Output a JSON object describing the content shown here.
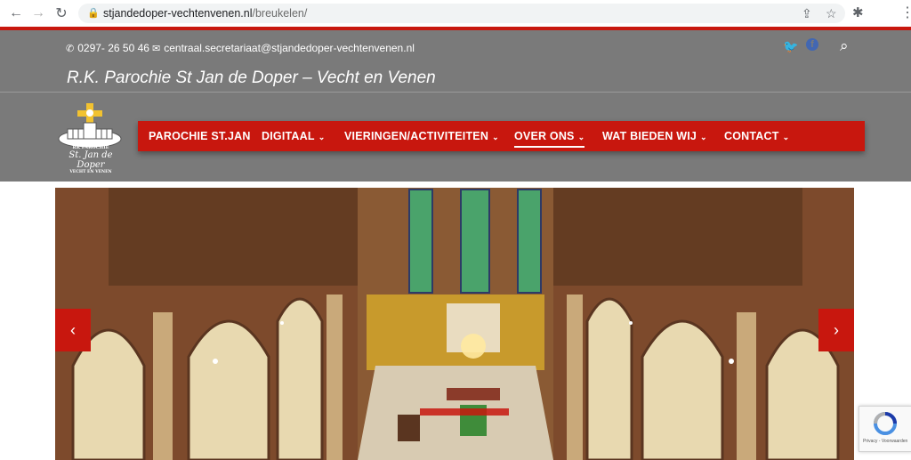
{
  "browser": {
    "url_domain": "stjandedoper-vechtenvenen.nl",
    "url_path": "/breukelen/",
    "back_icon": "←",
    "forward_icon": "→",
    "reload_icon": "↻",
    "lock_icon": "🔒",
    "share_icon": "⇪",
    "star_icon": "☆",
    "extensions_icon": "✱",
    "menu_icon": "⋮"
  },
  "topbar": {
    "phone_icon": "✆",
    "phone": "0297- 26 50 46",
    "email_icon": "✉",
    "email": "centraal.secretariaat@stjandedoper-vechtenvenen.nl",
    "twitter_icon": "🐦",
    "facebook_icon": "f",
    "search_icon": "⌕"
  },
  "site_title": "R.K. Parochie St Jan de Doper – Vecht en Venen",
  "logo": {
    "line1": "RK PAROCHIE",
    "line2": "St. Jan de Doper",
    "line3": "VECHT EN VENEN"
  },
  "nav": {
    "items": [
      {
        "label": "PAROCHIE ST.JAN",
        "chevron": ""
      },
      {
        "label": "DIGITAAL",
        "chevron": "⌄"
      },
      {
        "label": "VIERINGEN/ACTIVITEITEN",
        "chevron": "⌄"
      },
      {
        "label": "OVER ONS",
        "chevron": "⌄"
      },
      {
        "label": "WAT BIEDEN WIJ",
        "chevron": "⌄"
      },
      {
        "label": "CONTACT",
        "chevron": "⌄"
      }
    ]
  },
  "slider": {
    "prev_icon": "‹",
    "next_icon": "›"
  },
  "recaptcha": {
    "footer": "Privacy - Voorwaarden"
  },
  "colors": {
    "accent_red": "#c8170e",
    "header_gray": "#7a7a7a"
  }
}
